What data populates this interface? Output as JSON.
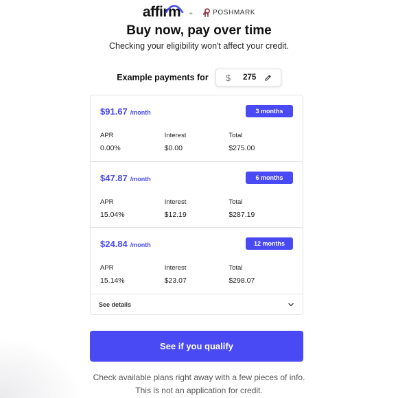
{
  "header": {
    "affirm_logo_text": "affirm",
    "plus": "+",
    "partner_name": "POSHMARK"
  },
  "title": "Buy now, pay over time",
  "subtitle": "Checking your eligibility won't affect your credit.",
  "example": {
    "label": "Example payments for",
    "currency_symbol": "$",
    "amount": "275"
  },
  "plans": [
    {
      "monthly_payment": "$91.67",
      "per_month": "/month",
      "term": "3 months",
      "apr_label": "APR",
      "apr": "0.00%",
      "interest_label": "Interest",
      "interest": "$0.00",
      "total_label": "Total",
      "total": "$275.00"
    },
    {
      "monthly_payment": "$47.87",
      "per_month": "/month",
      "term": "6 months",
      "apr_label": "APR",
      "apr": "15.04%",
      "interest_label": "Interest",
      "interest": "$12.19",
      "total_label": "Total",
      "total": "$287.19"
    },
    {
      "monthly_payment": "$24.84",
      "per_month": "/month",
      "term": "12 months",
      "apr_label": "APR",
      "apr": "15.14%",
      "interest_label": "Interest",
      "interest": "$23.07",
      "total_label": "Total",
      "total": "$298.07"
    }
  ],
  "see_details": "See details",
  "qualify_button": "See if you qualify",
  "footer": {
    "line1": "Check available plans right away with a few pieces of info.",
    "line2": "This is not an application for credit."
  },
  "colors": {
    "brand": "#4a4af4",
    "text": "#1a1a1a",
    "muted": "#555555",
    "border": "#e4e4e8"
  },
  "icons": {
    "edit": "pencil-icon",
    "expand": "chevron-down-icon",
    "partner": "poshmark-logo-icon"
  }
}
